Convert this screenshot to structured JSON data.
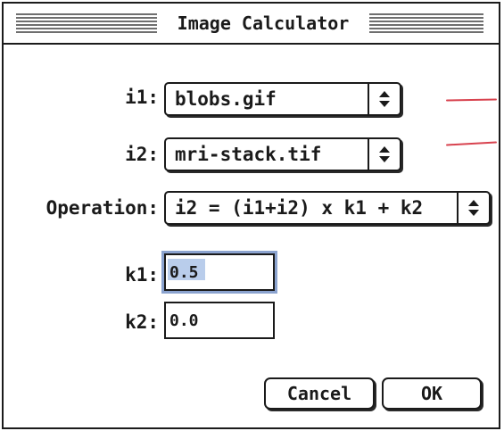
{
  "window": {
    "title": "Image Calculator"
  },
  "fields": {
    "i1": {
      "label": "i1:",
      "value": "blobs.gif"
    },
    "i2": {
      "label": "i2:",
      "value": "mri-stack.tif"
    },
    "operation": {
      "label": "Operation:",
      "value": "i2 = (i1+i2) x k1 + k2"
    },
    "k1": {
      "label": "k1:",
      "value": "0.5"
    },
    "k2": {
      "label": "k2:",
      "value": "0.0"
    }
  },
  "buttons": {
    "cancel": "Cancel",
    "ok": "OK"
  },
  "icons": {
    "popup_arrow": "up-down-arrows-icon"
  },
  "colors": {
    "annotation_marks": "#d8434f",
    "focus_ring": "#8ba3cf",
    "selection": "#b9cdeb"
  }
}
